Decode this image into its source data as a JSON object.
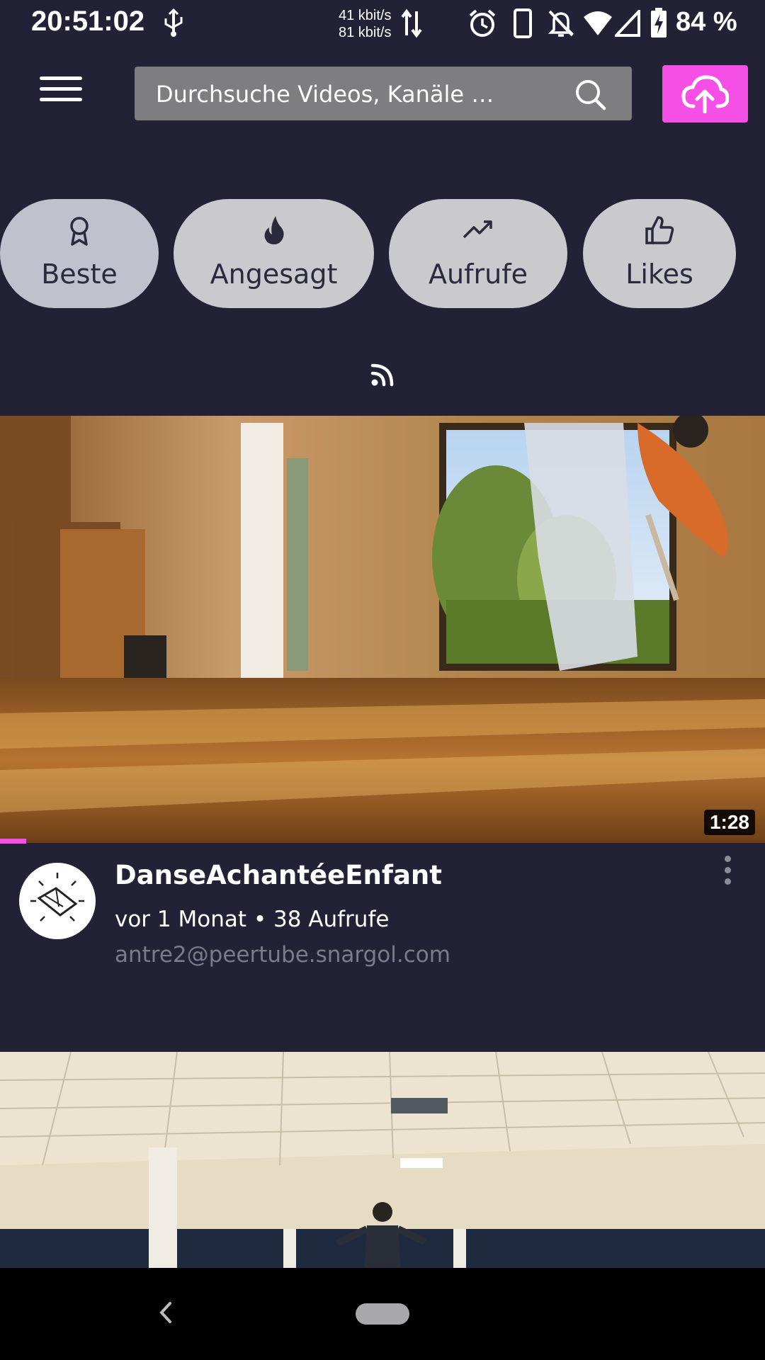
{
  "status_bar": {
    "time": "20:51:02",
    "net_up": "41 kbit/s",
    "net_down": "81 kbit/s",
    "battery": "84 %",
    "icons": [
      "usb-icon",
      "network-arrows-icon",
      "alarm-icon",
      "phone-icon",
      "bell-off-icon",
      "wifi-icon",
      "signal-icon",
      "battery-charging-icon"
    ]
  },
  "header": {
    "search_placeholder": "Durchsuche Videos, Kanäle …",
    "accent_color": "#f64fe6"
  },
  "filters": [
    {
      "label": "Beste",
      "icon": "award-icon"
    },
    {
      "label": "Angesagt",
      "icon": "flame-icon"
    },
    {
      "label": "Aufrufe",
      "icon": "trending-up-icon"
    },
    {
      "label": "Likes",
      "icon": "thumbs-up-icon"
    }
  ],
  "videos": [
    {
      "title": "DanseAchantéeEnfant",
      "meta": "vor 1 Monat • 38 Aufrufe",
      "account": "antre2@peertube.snargol.com",
      "duration": "1:28",
      "watched_fraction": 0.034
    }
  ]
}
